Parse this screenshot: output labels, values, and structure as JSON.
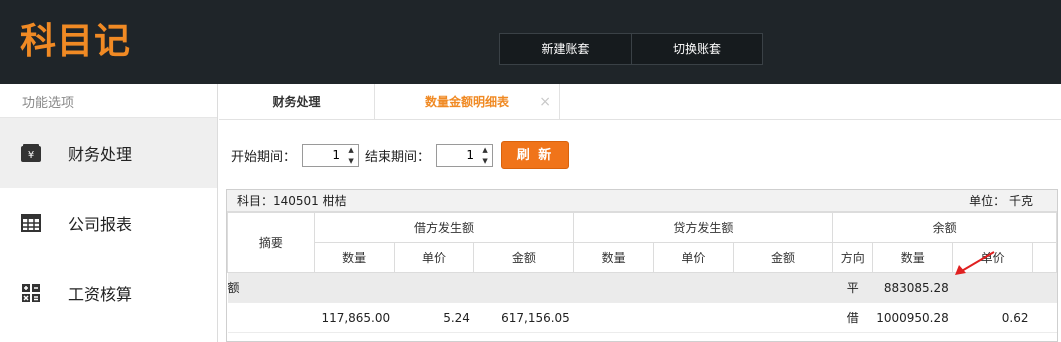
{
  "app": {
    "logo": "科目记"
  },
  "header": {
    "buttons": [
      "新建账套",
      "切换账套"
    ]
  },
  "sidebar": {
    "title": "功能选项",
    "items": [
      {
        "label": "财务处理",
        "icon": "yen-wallet-icon"
      },
      {
        "label": "公司报表",
        "icon": "table-grid-icon"
      },
      {
        "label": "工资核算",
        "icon": "calculator-icon"
      }
    ]
  },
  "tabs": [
    {
      "label": "财务处理"
    },
    {
      "label": "数量金额明细表",
      "close": "×"
    }
  ],
  "filter": {
    "start_label": "开始期间：",
    "start_value": "1",
    "end_label": "结束期间：",
    "end_value": "1",
    "refresh_label": "刷 新"
  },
  "report": {
    "subject": "科目：140501 柑桔",
    "unit": "单位：  千克",
    "headers": {
      "summary": "摘要",
      "debit": "借方发生额",
      "credit": "贷方发生额",
      "balance": "余额",
      "qty": "数量",
      "price": "单价",
      "amount": "金额",
      "direction": "方向"
    },
    "rows": [
      {
        "summary": "余额",
        "d_qty": "",
        "d_price": "",
        "d_amount": "",
        "c_qty": "",
        "c_price": "",
        "c_amount": "",
        "dir": "平",
        "b_qty": "883085.28",
        "b_price": ""
      },
      {
        "summary": "",
        "d_qty": "117,865.00",
        "d_price": "5.24",
        "d_amount": "617,156.05",
        "c_qty": "",
        "c_price": "",
        "c_amount": "",
        "dir": "借",
        "b_qty": "1000950.28",
        "b_price": "0.62"
      }
    ]
  },
  "colors": {
    "accent": "#f08a24",
    "button": "#f0741a",
    "header_bg": "#1f2529",
    "arrow": "#e02020"
  }
}
